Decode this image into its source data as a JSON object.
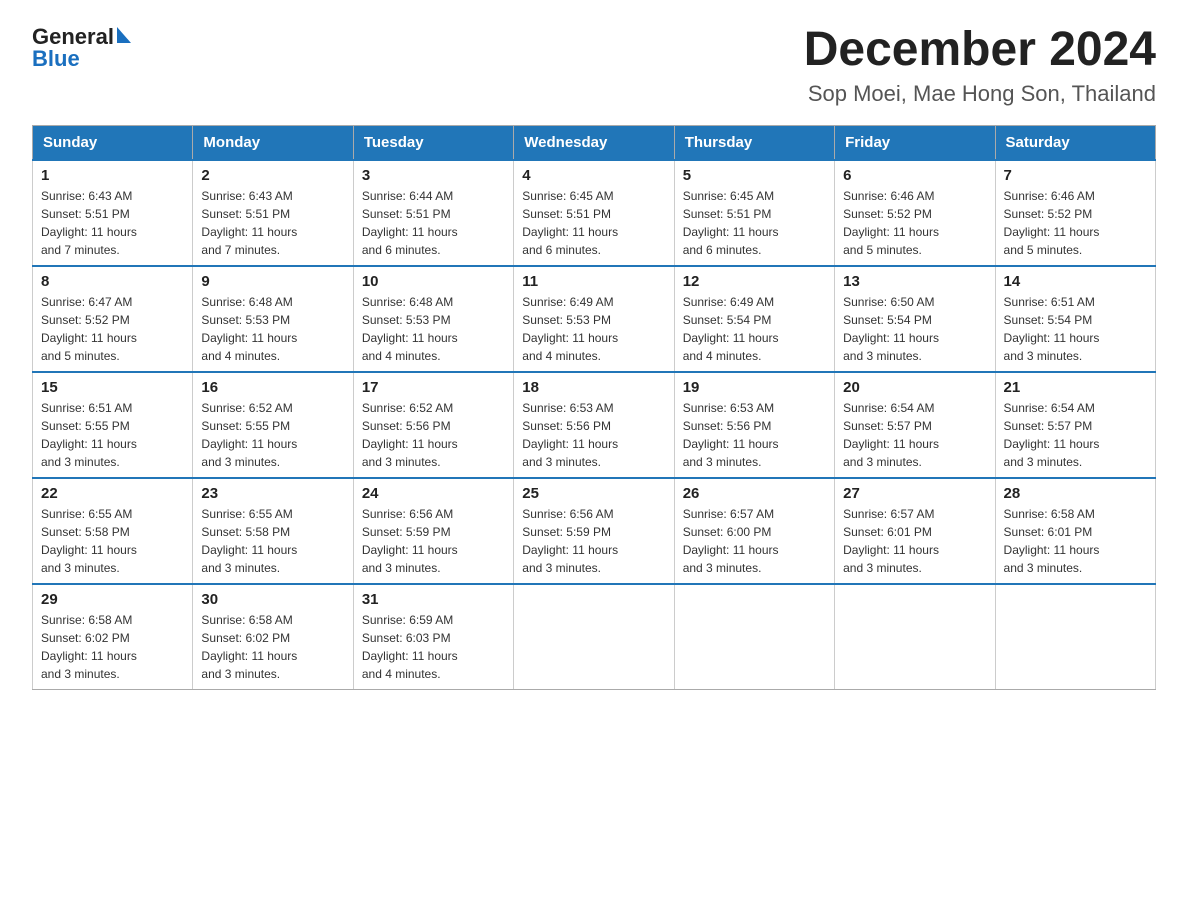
{
  "header": {
    "logo_general": "General",
    "logo_blue": "Blue",
    "title": "December 2024",
    "subtitle": "Sop Moei, Mae Hong Son, Thailand"
  },
  "calendar": {
    "days_of_week": [
      "Sunday",
      "Monday",
      "Tuesday",
      "Wednesday",
      "Thursday",
      "Friday",
      "Saturday"
    ],
    "weeks": [
      [
        {
          "day": "1",
          "sunrise": "6:43 AM",
          "sunset": "5:51 PM",
          "daylight": "11 hours and 7 minutes."
        },
        {
          "day": "2",
          "sunrise": "6:43 AM",
          "sunset": "5:51 PM",
          "daylight": "11 hours and 7 minutes."
        },
        {
          "day": "3",
          "sunrise": "6:44 AM",
          "sunset": "5:51 PM",
          "daylight": "11 hours and 6 minutes."
        },
        {
          "day": "4",
          "sunrise": "6:45 AM",
          "sunset": "5:51 PM",
          "daylight": "11 hours and 6 minutes."
        },
        {
          "day": "5",
          "sunrise": "6:45 AM",
          "sunset": "5:51 PM",
          "daylight": "11 hours and 6 minutes."
        },
        {
          "day": "6",
          "sunrise": "6:46 AM",
          "sunset": "5:52 PM",
          "daylight": "11 hours and 5 minutes."
        },
        {
          "day": "7",
          "sunrise": "6:46 AM",
          "sunset": "5:52 PM",
          "daylight": "11 hours and 5 minutes."
        }
      ],
      [
        {
          "day": "8",
          "sunrise": "6:47 AM",
          "sunset": "5:52 PM",
          "daylight": "11 hours and 5 minutes."
        },
        {
          "day": "9",
          "sunrise": "6:48 AM",
          "sunset": "5:53 PM",
          "daylight": "11 hours and 4 minutes."
        },
        {
          "day": "10",
          "sunrise": "6:48 AM",
          "sunset": "5:53 PM",
          "daylight": "11 hours and 4 minutes."
        },
        {
          "day": "11",
          "sunrise": "6:49 AM",
          "sunset": "5:53 PM",
          "daylight": "11 hours and 4 minutes."
        },
        {
          "day": "12",
          "sunrise": "6:49 AM",
          "sunset": "5:54 PM",
          "daylight": "11 hours and 4 minutes."
        },
        {
          "day": "13",
          "sunrise": "6:50 AM",
          "sunset": "5:54 PM",
          "daylight": "11 hours and 3 minutes."
        },
        {
          "day": "14",
          "sunrise": "6:51 AM",
          "sunset": "5:54 PM",
          "daylight": "11 hours and 3 minutes."
        }
      ],
      [
        {
          "day": "15",
          "sunrise": "6:51 AM",
          "sunset": "5:55 PM",
          "daylight": "11 hours and 3 minutes."
        },
        {
          "day": "16",
          "sunrise": "6:52 AM",
          "sunset": "5:55 PM",
          "daylight": "11 hours and 3 minutes."
        },
        {
          "day": "17",
          "sunrise": "6:52 AM",
          "sunset": "5:56 PM",
          "daylight": "11 hours and 3 minutes."
        },
        {
          "day": "18",
          "sunrise": "6:53 AM",
          "sunset": "5:56 PM",
          "daylight": "11 hours and 3 minutes."
        },
        {
          "day": "19",
          "sunrise": "6:53 AM",
          "sunset": "5:56 PM",
          "daylight": "11 hours and 3 minutes."
        },
        {
          "day": "20",
          "sunrise": "6:54 AM",
          "sunset": "5:57 PM",
          "daylight": "11 hours and 3 minutes."
        },
        {
          "day": "21",
          "sunrise": "6:54 AM",
          "sunset": "5:57 PM",
          "daylight": "11 hours and 3 minutes."
        }
      ],
      [
        {
          "day": "22",
          "sunrise": "6:55 AM",
          "sunset": "5:58 PM",
          "daylight": "11 hours and 3 minutes."
        },
        {
          "day": "23",
          "sunrise": "6:55 AM",
          "sunset": "5:58 PM",
          "daylight": "11 hours and 3 minutes."
        },
        {
          "day": "24",
          "sunrise": "6:56 AM",
          "sunset": "5:59 PM",
          "daylight": "11 hours and 3 minutes."
        },
        {
          "day": "25",
          "sunrise": "6:56 AM",
          "sunset": "5:59 PM",
          "daylight": "11 hours and 3 minutes."
        },
        {
          "day": "26",
          "sunrise": "6:57 AM",
          "sunset": "6:00 PM",
          "daylight": "11 hours and 3 minutes."
        },
        {
          "day": "27",
          "sunrise": "6:57 AM",
          "sunset": "6:01 PM",
          "daylight": "11 hours and 3 minutes."
        },
        {
          "day": "28",
          "sunrise": "6:58 AM",
          "sunset": "6:01 PM",
          "daylight": "11 hours and 3 minutes."
        }
      ],
      [
        {
          "day": "29",
          "sunrise": "6:58 AM",
          "sunset": "6:02 PM",
          "daylight": "11 hours and 3 minutes."
        },
        {
          "day": "30",
          "sunrise": "6:58 AM",
          "sunset": "6:02 PM",
          "daylight": "11 hours and 3 minutes."
        },
        {
          "day": "31",
          "sunrise": "6:59 AM",
          "sunset": "6:03 PM",
          "daylight": "11 hours and 4 minutes."
        },
        null,
        null,
        null,
        null
      ]
    ],
    "labels": {
      "sunrise": "Sunrise:",
      "sunset": "Sunset:",
      "daylight": "Daylight:"
    }
  }
}
